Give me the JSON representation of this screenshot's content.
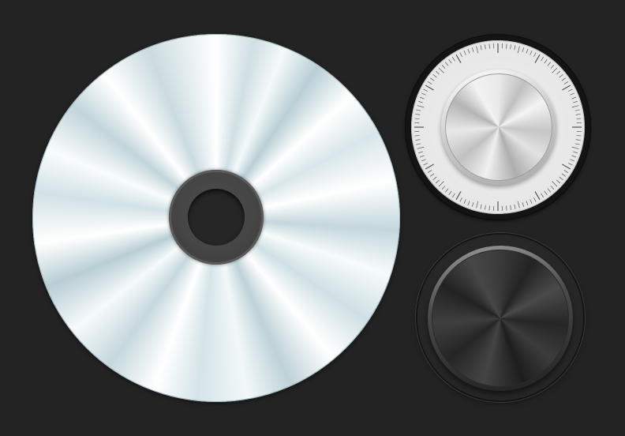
{
  "scene": {
    "background_color": "#232323",
    "items": [
      {
        "name": "cd-disc",
        "color": "#d2e2e6"
      },
      {
        "name": "silver-dial-knob",
        "color": "#d0d0d0",
        "tick_count": 120
      },
      {
        "name": "dark-knob",
        "color": "#333333"
      }
    ]
  }
}
